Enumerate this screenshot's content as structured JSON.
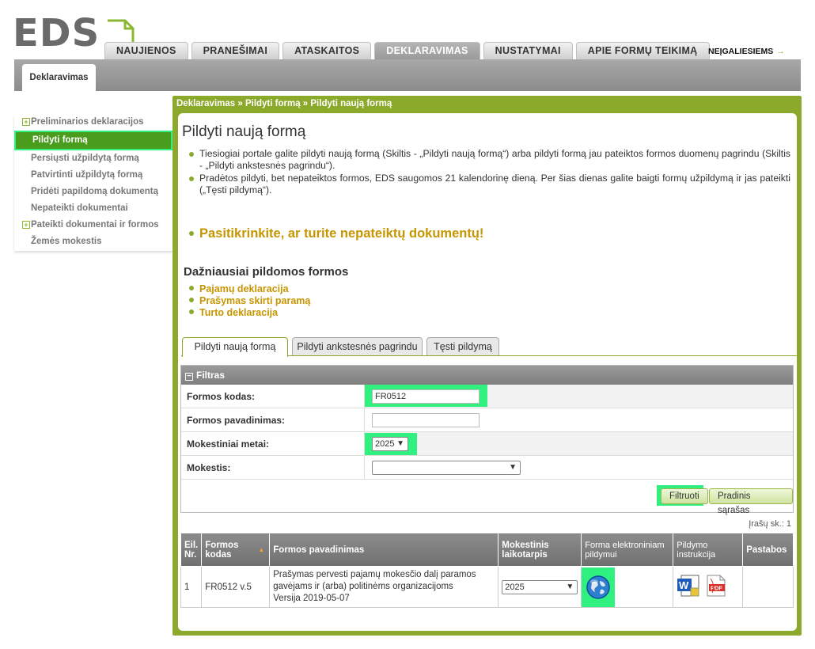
{
  "logo": {
    "text": "EDS"
  },
  "nav": {
    "tabs": [
      "NAUJIENOS",
      "PRANEŠIMAI",
      "ATASKAITOS",
      "DEKLARAVIMAS",
      "NUSTATYMAI",
      "APIE FORMŲ TEIKIMĄ"
    ],
    "active": "DEKLARAVIMAS",
    "accessibility": "NEĮGALIESIEMS",
    "accessibility_arrow": "→"
  },
  "subtab": "Deklaravimas",
  "sidebar": {
    "items": [
      {
        "label": "Preliminarios deklaracijos",
        "plus": true
      },
      {
        "label": "Pildyti formą",
        "active": true
      },
      {
        "label": "Persiųsti užpildytą formą"
      },
      {
        "label": "Patvirtinti užpildytą formą"
      },
      {
        "label": "Pridėti papildomą dokumentą"
      },
      {
        "label": "Nepateikti dokumentai"
      },
      {
        "label": "Pateikti dokumentai ir formos",
        "plus": true
      },
      {
        "label": "Žemės mokestis"
      }
    ]
  },
  "breadcrumb": "Deklaravimas » Pildyti formą » Pildyti naują formą",
  "page_title": "Pildyti naują formą",
  "intro": [
    "Tiesiogiai portale galite pildyti naują formą (Skiltis - „Pildyti naują formą“) arba pildyti formą jau pateiktos formos duomenų pagrindu (Skiltis - „Pildyti ankstesnės pagrindu“).",
    "Pradėtos pildyti, bet nepateiktos formos, EDS saugomos 21 kalendorinę dieną. Per šias dienas galite baigti formų užpildymą ir jas pateikti („Tęsti pildymą“)."
  ],
  "check_link": "Pasitikrinkite, ar turite nepateiktų dokumentų!",
  "frequent": {
    "title": "Dažniausiai pildomos formos",
    "items": [
      "Pajamų deklaracija",
      "Prašymas skirti paramą",
      "Turto deklaracija"
    ]
  },
  "form_tabs": [
    "Pildyti naują formą",
    "Pildyti ankstesnės pagrindu",
    "Tęsti pildymą"
  ],
  "filter": {
    "title": "Filtras",
    "code_label": "Formos kodas:",
    "code_value": "FR0512",
    "name_label": "Formos pavadinimas:",
    "name_value": "",
    "year_label": "Mokestiniai metai:",
    "year_value": "2025",
    "tax_label": "Mokestis:",
    "tax_value": "",
    "filter_button": "Filtruoti",
    "reset_button": "Pradinis sąrašas"
  },
  "record_count": "Įrašų sk.: 1",
  "table": {
    "headers": {
      "no": "Eil. Nr.",
      "code": "Formos kodas",
      "name": "Formos pavadinimas",
      "period": "Mokestinis laikotarpis",
      "electronic": "Forma elektroniniam pildymui",
      "instructions": "Pildymo instrukcija",
      "notes": "Pastabos"
    },
    "sort_arrow": "▲",
    "rows": [
      {
        "no": "1",
        "code": "FR0512 v.5",
        "name": "Prašymas pervesti pajamų mokesčio dalį paramos gavėjams ir (arba) politinėms organizacijoms",
        "version": "Versija 2019-05-07",
        "period": "2025",
        "notes": ""
      }
    ]
  },
  "icons": {
    "globe": "globe-icon",
    "word": "word-document-icon",
    "pdf": "pdf-document-icon"
  },
  "colors": {
    "accent_green": "#8ba92a",
    "link_gold": "#c69500",
    "highlight": "#30f080"
  }
}
